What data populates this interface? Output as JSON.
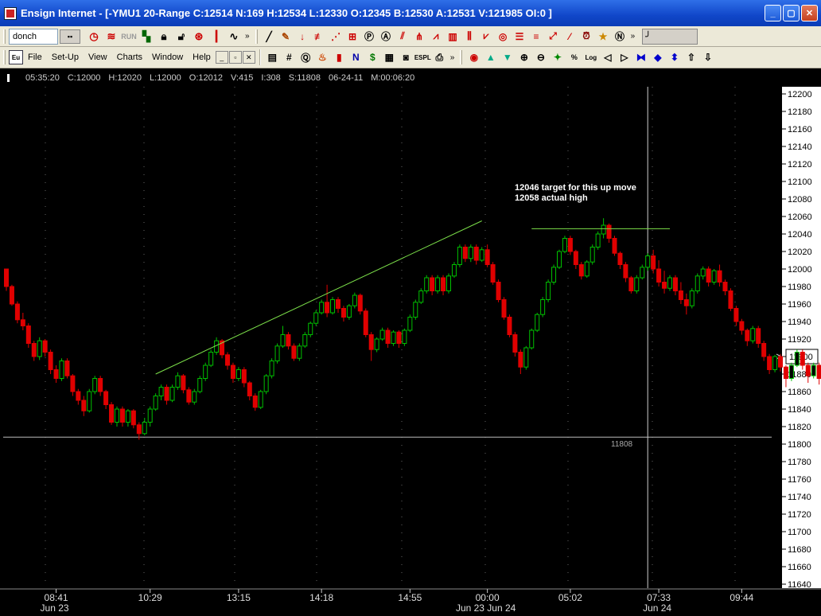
{
  "window": {
    "title": "Ensign Internet - [-YMU1 20-Range C:12514 N:169 H:12534 L:12330 O:12345 B:12530 A:12531 V:121985 OI:0 ]",
    "min_label": "_",
    "max_label": "▢",
    "close_label": "✕"
  },
  "toolbar1": {
    "combo_value": "donch",
    "combo_btn": "▪▪",
    "more1": "»",
    "more2": "»",
    "slider_label": "╯"
  },
  "toolbar2": {
    "menu": [
      "File",
      "Set-Up",
      "View",
      "Charts",
      "Window",
      "Help"
    ],
    "more": "»"
  },
  "infobar": {
    "time": "05:35:20",
    "close": "C:12000",
    "high": "H:12020",
    "low": "L:12000",
    "open": "O:12012",
    "volume": "V:415",
    "index": "I:308",
    "s": "S:11808",
    "date": "06-24-11",
    "m": "M:00:06:20"
  },
  "colors": {
    "background": "#000000",
    "up_candle": "#00c000",
    "down_candle": "#e00000",
    "trendline": "#7ce04a",
    "crosshair": "#cfcfcf",
    "annotation": "#ffffff"
  },
  "chart_data": {
    "type": "candlestick",
    "instrument": "-YMU1 20-Range",
    "ylim": [
      11630,
      12210
    ],
    "y_ticks": [
      12200,
      12180,
      12160,
      12140,
      12120,
      12100,
      12080,
      12060,
      12040,
      12020,
      12000,
      11980,
      11960,
      11940,
      11920,
      11900,
      11880,
      11860,
      11840,
      11820,
      11800,
      11780,
      11760,
      11740,
      11720,
      11700,
      11680,
      11660,
      11640
    ],
    "current_price": "11900",
    "x_labels": [
      {
        "time": "08:41",
        "date": "Jun 23",
        "bar": 9
      },
      {
        "time": "10:29",
        "date": "",
        "bar": 26
      },
      {
        "time": "13:15",
        "date": "",
        "bar": 42
      },
      {
        "time": "14:18",
        "date": "",
        "bar": 57
      },
      {
        "time": "14:55",
        "date": "",
        "bar": 73
      },
      {
        "time": "00:00",
        "date": "Jun 23  Jun 24",
        "bar": 87
      },
      {
        "time": "05:02",
        "date": "",
        "bar": 102
      },
      {
        "time": "07:33",
        "date": "Jun 24",
        "bar": 118
      },
      {
        "time": "09:44",
        "date": "",
        "bar": 133
      }
    ],
    "bars": [
      [
        12000,
        11980,
        12000,
        11975
      ],
      [
        11980,
        11960,
        11982,
        11958
      ],
      [
        11960,
        11942,
        11963,
        11938
      ],
      [
        11942,
        11935,
        11950,
        11930
      ],
      [
        11935,
        11915,
        11938,
        11910
      ],
      [
        11915,
        11900,
        11918,
        11895
      ],
      [
        11900,
        11918,
        11922,
        11896
      ],
      [
        11918,
        11905,
        11920,
        11900
      ],
      [
        11905,
        11885,
        11908,
        11880
      ],
      [
        11885,
        11875,
        11890,
        11870
      ],
      [
        11875,
        11895,
        11898,
        11872
      ],
      [
        11895,
        11878,
        11898,
        11875
      ],
      [
        11878,
        11860,
        11880,
        11855
      ],
      [
        11860,
        11850,
        11863,
        11845
      ],
      [
        11850,
        11838,
        11855,
        11832
      ],
      [
        11838,
        11860,
        11863,
        11836
      ],
      [
        11860,
        11875,
        11878,
        11857
      ],
      [
        11875,
        11860,
        11878,
        11855
      ],
      [
        11860,
        11845,
        11862,
        11840
      ],
      [
        11845,
        11825,
        11848,
        11822
      ],
      [
        11825,
        11840,
        11843,
        11820
      ],
      [
        11840,
        11825,
        11843,
        11820
      ],
      [
        11825,
        11838,
        11840,
        11820
      ],
      [
        11838,
        11822,
        11840,
        11818
      ],
      [
        11822,
        11812,
        11825,
        11805
      ],
      [
        11812,
        11825,
        11830,
        11810
      ],
      [
        11825,
        11840,
        11843,
        11820
      ],
      [
        11840,
        11855,
        11858,
        11838
      ],
      [
        11855,
        11865,
        11868,
        11850
      ],
      [
        11865,
        11850,
        11868,
        11845
      ],
      [
        11850,
        11865,
        11868,
        11848
      ],
      [
        11865,
        11878,
        11882,
        11862
      ],
      [
        11878,
        11862,
        11880,
        11858
      ],
      [
        11862,
        11848,
        11865,
        11845
      ],
      [
        11848,
        11860,
        11863,
        11845
      ],
      [
        11860,
        11875,
        11878,
        11858
      ],
      [
        11875,
        11890,
        11893,
        11872
      ],
      [
        11890,
        11905,
        11908,
        11888
      ],
      [
        11905,
        11918,
        11922,
        11902
      ],
      [
        11918,
        11902,
        11920,
        11898
      ],
      [
        11902,
        11890,
        11905,
        11885
      ],
      [
        11890,
        11875,
        11893,
        11870
      ],
      [
        11875,
        11885,
        11888,
        11872
      ],
      [
        11885,
        11870,
        11888,
        11865
      ],
      [
        11870,
        11855,
        11872,
        11850
      ],
      [
        11855,
        11842,
        11858,
        11838
      ],
      [
        11842,
        11860,
        11862,
        11840
      ],
      [
        11860,
        11878,
        11880,
        11857
      ],
      [
        11878,
        11895,
        11898,
        11875
      ],
      [
        11895,
        11912,
        11915,
        11892
      ],
      [
        11912,
        11925,
        11935,
        11910
      ],
      [
        11925,
        11912,
        11928,
        11908
      ],
      [
        11912,
        11898,
        11915,
        11895
      ],
      [
        11898,
        11912,
        11915,
        11895
      ],
      [
        11912,
        11925,
        11928,
        11910
      ],
      [
        11925,
        11938,
        11940,
        11922
      ],
      [
        11938,
        11950,
        11953,
        11935
      ],
      [
        11950,
        11962,
        11965,
        11948
      ],
      [
        11962,
        11950,
        11982,
        11945
      ],
      [
        11950,
        11965,
        11968,
        11948
      ],
      [
        11965,
        11955,
        11968,
        11950
      ],
      [
        11955,
        11945,
        11958,
        11940
      ],
      [
        11945,
        11958,
        11960,
        11942
      ],
      [
        11958,
        11970,
        11973,
        11955
      ],
      [
        11970,
        11952,
        11972,
        11948
      ],
      [
        11952,
        11925,
        11955,
        11922
      ],
      [
        11925,
        11908,
        11928,
        11895
      ],
      [
        11908,
        11920,
        11922,
        11905
      ],
      [
        11920,
        11930,
        11933,
        11918
      ],
      [
        11930,
        11915,
        11933,
        11910
      ],
      [
        11915,
        11928,
        11930,
        11912
      ],
      [
        11928,
        11915,
        11930,
        11910
      ],
      [
        11915,
        11930,
        11932,
        11912
      ],
      [
        11930,
        11945,
        11948,
        11928
      ],
      [
        11945,
        11962,
        11965,
        11942
      ],
      [
        11962,
        11975,
        11978,
        11960
      ],
      [
        11975,
        11990,
        11993,
        11972
      ],
      [
        11990,
        11975,
        11993,
        11970
      ],
      [
        11975,
        11990,
        11993,
        11972
      ],
      [
        11990,
        11975,
        11993,
        11970
      ],
      [
        11975,
        11992,
        11995,
        11972
      ],
      [
        11992,
        12005,
        12008,
        11990
      ],
      [
        12005,
        12025,
        12028,
        12002
      ],
      [
        12025,
        12012,
        12028,
        12008
      ],
      [
        12012,
        12025,
        12028,
        12008
      ],
      [
        12025,
        12010,
        12028,
        12005
      ],
      [
        12010,
        12022,
        12025,
        12008
      ],
      [
        12022,
        12005,
        12028,
        12002
      ],
      [
        12005,
        11985,
        12008,
        11982
      ],
      [
        11985,
        11965,
        11988,
        11962
      ],
      [
        11965,
        11945,
        11968,
        11942
      ],
      [
        11945,
        11925,
        11948,
        11922
      ],
      [
        11925,
        11905,
        11928,
        11900
      ],
      [
        11905,
        11888,
        11908,
        11880
      ],
      [
        11888,
        11910,
        11912,
        11885
      ],
      [
        11910,
        11930,
        11932,
        11908
      ],
      [
        11930,
        11948,
        11950,
        11928
      ],
      [
        11948,
        11965,
        11968,
        11945
      ],
      [
        11965,
        11985,
        11988,
        11962
      ],
      [
        11985,
        12002,
        12005,
        11982
      ],
      [
        12002,
        12020,
        12022,
        12000
      ],
      [
        12020,
        12035,
        12038,
        12018
      ],
      [
        12035,
        12020,
        12038,
        12016
      ],
      [
        12020,
        12005,
        12022,
        12000
      ],
      [
        12005,
        11992,
        12008,
        11988
      ],
      [
        11992,
        12008,
        12010,
        11990
      ],
      [
        12008,
        12025,
        12028,
        12005
      ],
      [
        12025,
        12040,
        12043,
        12022
      ],
      [
        12040,
        12050,
        12058,
        12035
      ],
      [
        12050,
        12035,
        12052,
        12030
      ],
      [
        12035,
        12018,
        12038,
        12015
      ],
      [
        12018,
        12005,
        12020,
        12000
      ],
      [
        12005,
        11990,
        12008,
        11985
      ],
      [
        11990,
        11975,
        11992,
        11972
      ],
      [
        11975,
        11990,
        11993,
        11972
      ],
      [
        11990,
        12002,
        12005,
        11988
      ],
      [
        12002,
        12015,
        12018,
        11998
      ],
      [
        12015,
        12000,
        12022,
        11995
      ],
      [
        12000,
        11985,
        12010,
        11980
      ],
      [
        11985,
        11978,
        11998,
        11972
      ],
      [
        11978,
        11990,
        11993,
        11975
      ],
      [
        11990,
        11975,
        11993,
        11970
      ],
      [
        11975,
        11965,
        11985,
        11960
      ],
      [
        11965,
        11958,
        11972,
        11948
      ],
      [
        11958,
        11975,
        11978,
        11955
      ],
      [
        11975,
        11992,
        11995,
        11972
      ],
      [
        11992,
        12000,
        12003,
        11988
      ],
      [
        12000,
        11985,
        12003,
        11980
      ],
      [
        11985,
        11998,
        12000,
        11982
      ],
      [
        11998,
        11985,
        12005,
        11980
      ],
      [
        11985,
        11975,
        11988,
        11970
      ],
      [
        11975,
        11955,
        11978,
        11952
      ],
      [
        11955,
        11940,
        11958,
        11935
      ],
      [
        11940,
        11930,
        11943,
        11925
      ],
      [
        11930,
        11918,
        11932,
        11912
      ],
      [
        11918,
        11932,
        11935,
        11915
      ],
      [
        11932,
        11915,
        11935,
        11910
      ],
      [
        11915,
        11900,
        11918,
        11895
      ],
      [
        11900,
        11885,
        11903,
        11880
      ],
      [
        11885,
        11900,
        11902,
        11882
      ],
      [
        11900,
        11888,
        11903,
        11883
      ],
      [
        11888,
        11875,
        11890,
        11865
      ],
      [
        11875,
        11890,
        11893,
        11872
      ],
      [
        11890,
        11905,
        11908,
        11888
      ],
      [
        11905,
        11890,
        11908,
        11885
      ],
      [
        11890,
        11878,
        11893,
        11870
      ],
      [
        11878,
        11890,
        11893,
        11875
      ],
      [
        11890,
        11875,
        11893,
        11868
      ],
      [
        11875,
        11888,
        11890,
        11872
      ],
      [
        11888,
        11875,
        11890,
        11870
      ],
      [
        11875,
        11890,
        11893,
        11872
      ],
      [
        11890,
        11878,
        11893,
        11873
      ],
      [
        11878,
        11865,
        11880,
        11860
      ],
      [
        11865,
        11880,
        11883,
        11862
      ],
      [
        11880,
        11890,
        11893,
        11878
      ],
      [
        11890,
        11900,
        11903,
        11888
      ]
    ],
    "trendline": {
      "from": {
        "bar": 27,
        "price": 11880
      },
      "to": {
        "bar": 86,
        "price": 12055
      }
    },
    "target_line": {
      "price": 12046,
      "from_bar": 95,
      "to_bar": 120
    },
    "support_line": {
      "price": 11808,
      "label": "11808"
    },
    "crosshair": {
      "bar": 116
    },
    "annotations": [
      "12046 target for this up move",
      "12058 actual high"
    ]
  }
}
